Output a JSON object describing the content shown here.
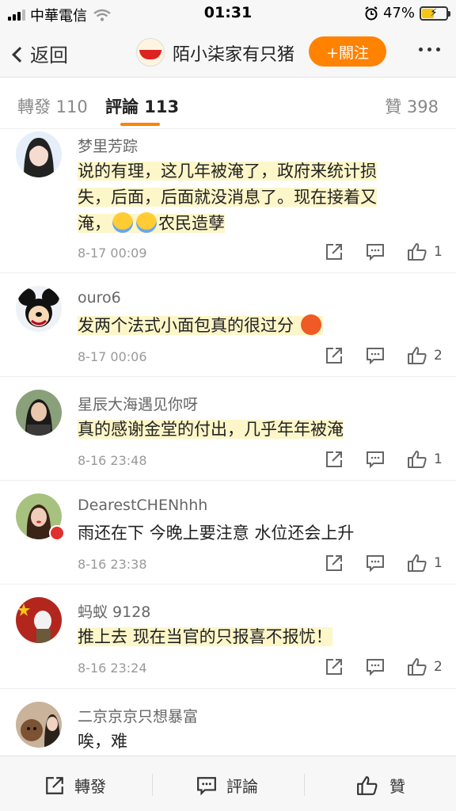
{
  "status": {
    "carrier": "中華電信",
    "time": "01:31",
    "battery": "47%",
    "battery_level": 0.47
  },
  "nav": {
    "back_label": "返回",
    "title": "陌小柒家有只猪",
    "follow_label": "+關注"
  },
  "tabs": {
    "repost": "轉發 110",
    "comments": "評論 113",
    "likes": "贊 398"
  },
  "comments": [
    {
      "user": "梦里芳踪",
      "line1": "说的有理，这几年被淹了，政府来统计损",
      "line2": "失，后面，后面就没消息了。现在接着又",
      "line3_pre": "淹，",
      "line3_post": "农民造孽",
      "time": "8-17 00:09",
      "likes": "1"
    },
    {
      "user": "ouro6",
      "text": "发两个法式小面包真的很过分",
      "time": "8-17 00:06",
      "likes": "2"
    },
    {
      "user": "星辰大海遇见你呀",
      "text": "真的感谢金堂的付出，几乎年年被淹",
      "time": "8-16 23:48",
      "likes": "1"
    },
    {
      "user": "DearestCHENhhh",
      "text": "雨还在下 今晚上要注意 水位还会上升",
      "time": "8-16 23:38",
      "likes": "1"
    },
    {
      "user": "蚂蚁 9128",
      "text": "推上去 现在当官的只报喜不报忧！",
      "time": "8-16 23:24",
      "likes": "2"
    },
    {
      "user": "二京京京只想暴富",
      "text": "唉，难"
    }
  ],
  "bottom": {
    "repost": "轉發",
    "comment": "評論",
    "like": "贊"
  },
  "colors": {
    "accent": "#ff8200",
    "highlight": "#fdf6c9"
  }
}
